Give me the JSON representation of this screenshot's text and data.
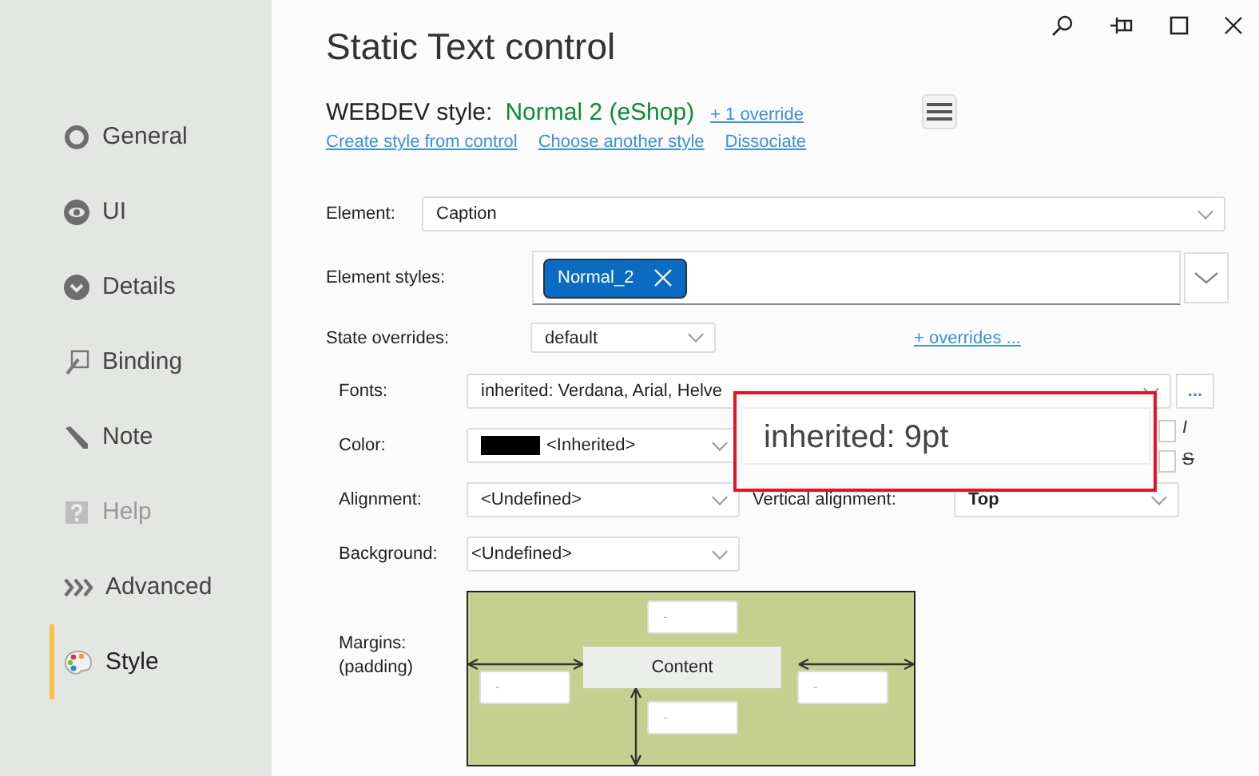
{
  "window": {
    "title": "Static Text control"
  },
  "sidebar": {
    "items": [
      {
        "label": "General",
        "disabled": false,
        "selected": false
      },
      {
        "label": "UI",
        "disabled": false,
        "selected": false
      },
      {
        "label": "Details",
        "disabled": false,
        "selected": false
      },
      {
        "label": "Binding",
        "disabled": false,
        "selected": false
      },
      {
        "label": "Note",
        "disabled": false,
        "selected": false
      },
      {
        "label": "Help",
        "disabled": true,
        "selected": false
      },
      {
        "label": "Advanced",
        "disabled": false,
        "selected": false
      },
      {
        "label": "Style",
        "disabled": false,
        "selected": true
      }
    ]
  },
  "style_header": {
    "label": "WEBDEV style:",
    "style_name": "Normal 2 (eShop)",
    "override_link": "+ 1 override"
  },
  "links": [
    "Create style from control",
    "Choose another style",
    "Dissociate"
  ],
  "element": {
    "label": "Element:",
    "value": "Caption"
  },
  "element_styles": {
    "label": "Element styles:",
    "tags": [
      "Normal_2"
    ]
  },
  "state_overrides": {
    "label": "State overrides:",
    "value": "default",
    "link": "+ overrides ..."
  },
  "fonts": {
    "label": "Fonts:",
    "value": "inherited: Verdana, Arial, Helve",
    "more_button": "...",
    "italic": "I",
    "italic_checked": false,
    "strike": "S",
    "strike_checked": false
  },
  "size_popup": {
    "value": "inherited: 9pt"
  },
  "color": {
    "label": "Color:",
    "value": "<Inherited>"
  },
  "alignment": {
    "label": "Alignment:",
    "value": "<Undefined>",
    "vertical_label": "Vertical alignment:",
    "vertical_value": "Top"
  },
  "background": {
    "label": "Background:",
    "value": "<Undefined>"
  },
  "margins": {
    "label": "Margins:",
    "sublabel": "(padding)",
    "content": "Content",
    "top": "-",
    "left": "-",
    "right": "-",
    "bottom": "-"
  }
}
